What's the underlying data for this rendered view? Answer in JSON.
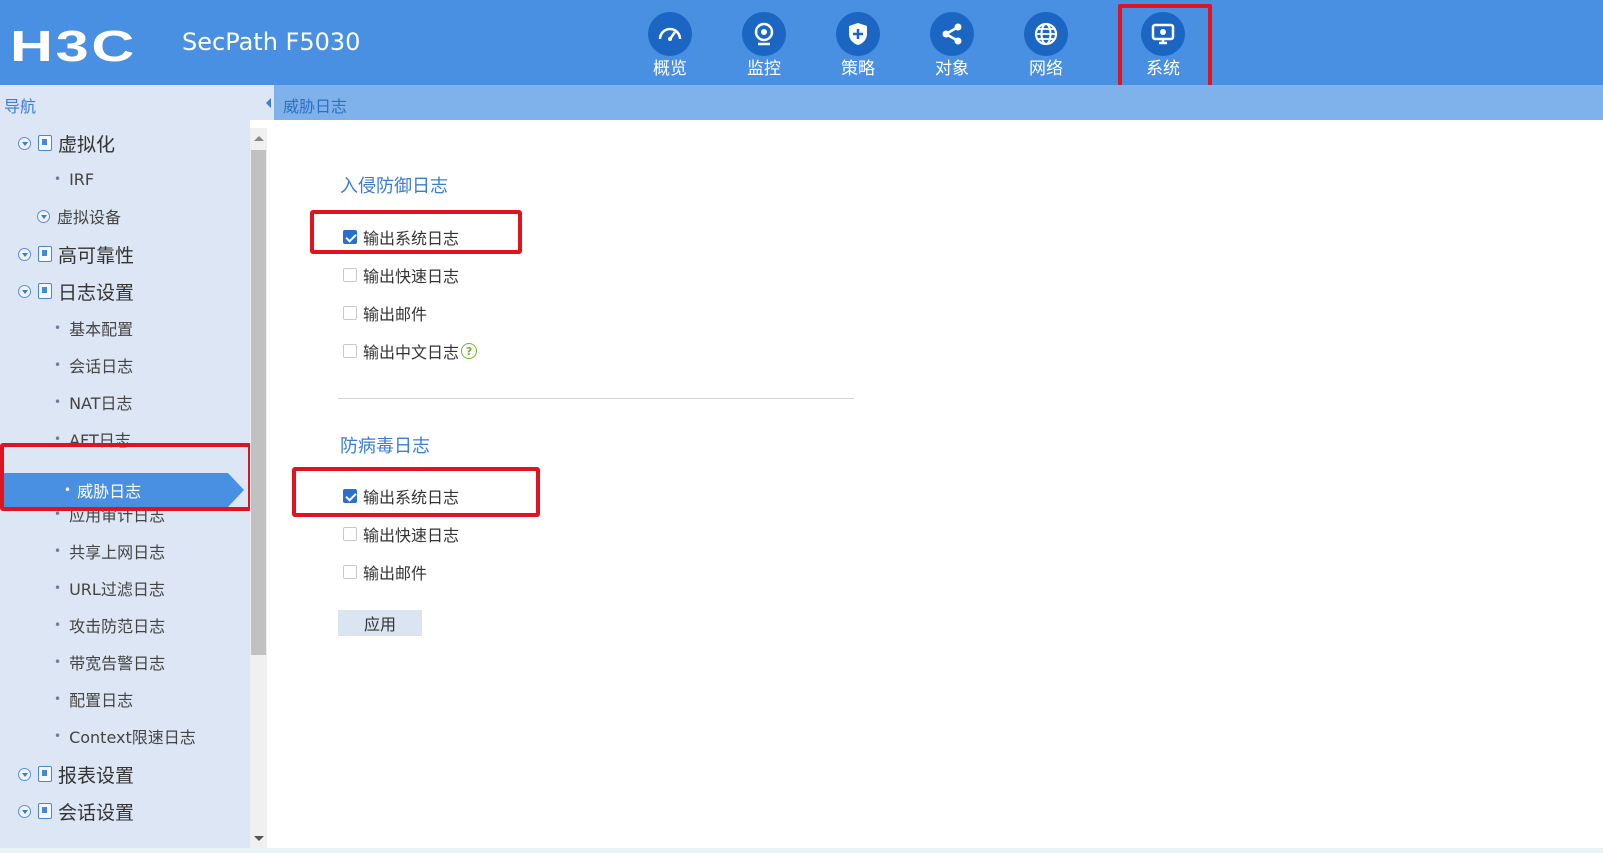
{
  "header": {
    "logo": "H3C",
    "product": "SecPath F5030",
    "nav": [
      {
        "label": "概览",
        "icon": "speedometer-icon"
      },
      {
        "label": "监控",
        "icon": "webcam-icon"
      },
      {
        "label": "策略",
        "icon": "shield-plus-icon"
      },
      {
        "label": "对象",
        "icon": "share-nodes-icon"
      },
      {
        "label": "网络",
        "icon": "globe-icon"
      },
      {
        "label": "系统",
        "icon": "monitor-gear-icon",
        "active": true
      }
    ]
  },
  "sidebar": {
    "title": "导航",
    "items": [
      {
        "label": "虚拟化",
        "level": 1
      },
      {
        "label": "IRF",
        "level": 3
      },
      {
        "label": "虚拟设备",
        "level": 2
      },
      {
        "label": "高可靠性",
        "level": 1
      },
      {
        "label": "日志设置",
        "level": 1
      },
      {
        "label": "基本配置",
        "level": 3
      },
      {
        "label": "会话日志",
        "level": 3
      },
      {
        "label": "NAT日志",
        "level": 3
      },
      {
        "label": "AFT日志",
        "level": 3
      },
      {
        "label": "威胁日志",
        "level": 3,
        "selected": true
      },
      {
        "label": "应用审计日志",
        "level": 3
      },
      {
        "label": "共享上网日志",
        "level": 3
      },
      {
        "label": "URL过滤日志",
        "level": 3
      },
      {
        "label": "攻击防范日志",
        "level": 3
      },
      {
        "label": "带宽告警日志",
        "level": 3
      },
      {
        "label": "配置日志",
        "level": 3
      },
      {
        "label": "Context限速日志",
        "level": 3
      },
      {
        "label": "报表设置",
        "level": 1
      },
      {
        "label": "会话设置",
        "level": 1
      }
    ]
  },
  "content": {
    "title": "威胁日志",
    "sections": [
      {
        "title": "入侵防御日志",
        "options": [
          {
            "label": "输出系统日志",
            "checked": true
          },
          {
            "label": "输出快速日志",
            "checked": false
          },
          {
            "label": "输出邮件",
            "checked": false
          },
          {
            "label": "输出中文日志",
            "checked": false,
            "help": "?"
          }
        ]
      },
      {
        "title": "防病毒日志",
        "options": [
          {
            "label": "输出系统日志",
            "checked": true
          },
          {
            "label": "输出快速日志",
            "checked": false
          },
          {
            "label": "输出邮件",
            "checked": false
          }
        ]
      }
    ],
    "apply_label": "应用"
  },
  "colors": {
    "topbar": "#4a90e2",
    "nav_circle": "#1a66c2",
    "highlight": "#e0141e",
    "sidebar": "#dde6f4"
  }
}
